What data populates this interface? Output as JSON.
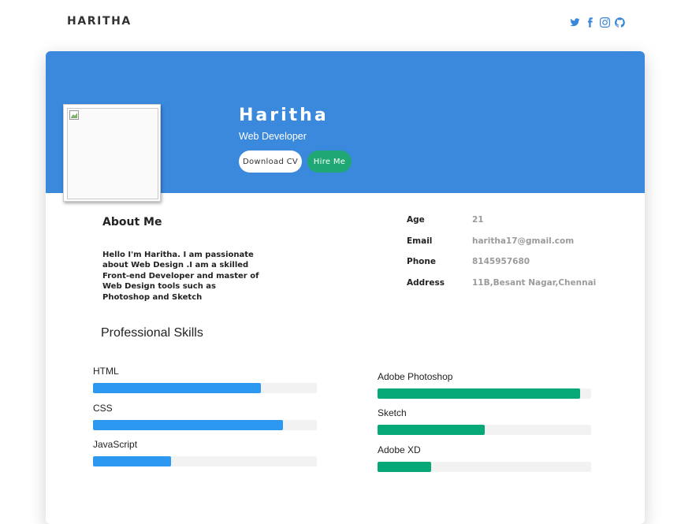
{
  "nav": {
    "brand": "HARITHA",
    "social_icons": [
      "twitter-icon",
      "facebook-icon",
      "instagram-icon",
      "github-icon"
    ]
  },
  "colors": {
    "hero": "#3a89dd",
    "accent_blue": "#2c98f0",
    "accent_green": "#07a877",
    "hire_button": "#1fa774"
  },
  "profile": {
    "name": "Haritha",
    "role": "Web Developer",
    "download_label": "Download CV",
    "hire_label": "Hire Me"
  },
  "about": {
    "title": "About Me",
    "text": "Hello I'm Haritha. I am passionate about Web Design .I am a skilled Front-end Developer and master of Web Design tools such as Photoshop and Sketch"
  },
  "info": [
    {
      "label": "Age",
      "value": "21"
    },
    {
      "label": "Email",
      "value": "haritha17@gmail.com"
    },
    {
      "label": "Phone",
      "value": "8145957680"
    },
    {
      "label": "Address",
      "value": "11B,Besant Nagar,Chennai"
    }
  ],
  "skills": {
    "title": "Professional Skills",
    "left": [
      {
        "label": "HTML",
        "percent": 75
      },
      {
        "label": "CSS",
        "percent": 85
      },
      {
        "label": "JavaScript",
        "percent": 35
      }
    ],
    "right": [
      {
        "label": "Adobe Photoshop",
        "percent": 95
      },
      {
        "label": "Sketch",
        "percent": 50
      },
      {
        "label": "Adobe XD",
        "percent": 25
      }
    ]
  }
}
